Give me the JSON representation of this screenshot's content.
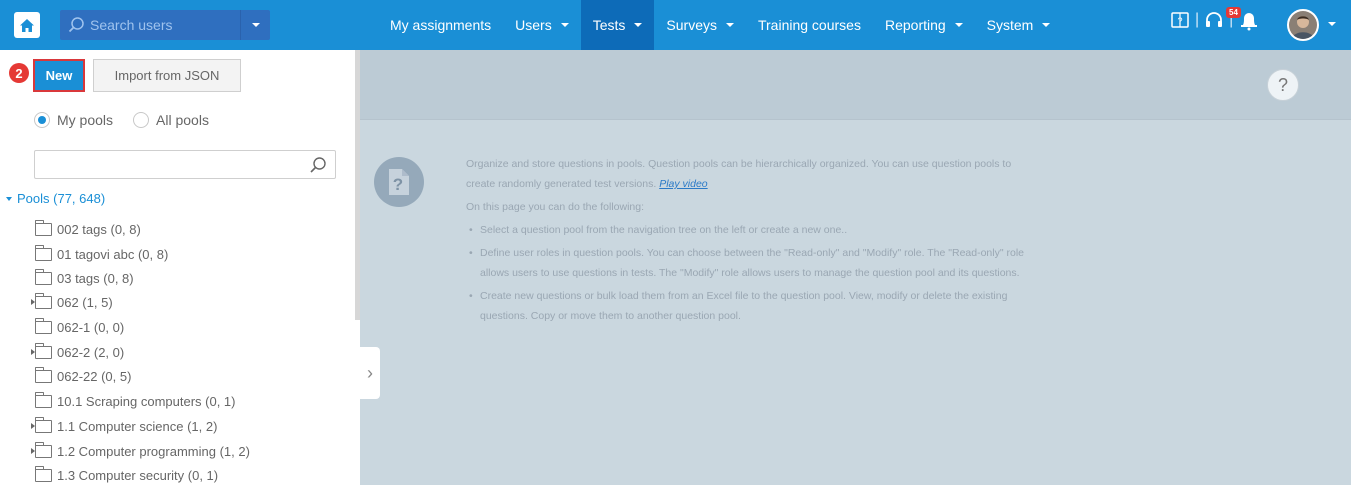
{
  "header": {
    "search_placeholder": "Search users",
    "nav": [
      {
        "label": "My assignments",
        "dropdown": false,
        "active": false
      },
      {
        "label": "Users",
        "dropdown": true,
        "active": false
      },
      {
        "label": "Tests",
        "dropdown": true,
        "active": true
      },
      {
        "label": "Surveys",
        "dropdown": true,
        "active": false
      },
      {
        "label": "Training courses",
        "dropdown": false,
        "active": false
      },
      {
        "label": "Reporting",
        "dropdown": true,
        "active": false
      },
      {
        "label": "System",
        "dropdown": true,
        "active": false
      }
    ],
    "notification_count": "54",
    "icons": [
      "home-icon",
      "search-icon",
      "manual-icon",
      "headset-icon",
      "bell-icon",
      "avatar"
    ]
  },
  "toolbar": {
    "step_number": "2",
    "new_label": "New",
    "import_label": "Import from JSON"
  },
  "filter": {
    "my_pools_label": "My pools",
    "all_pools_label": "All pools",
    "selected": "My pools"
  },
  "tree": {
    "root_label": "Pools (77, 648)",
    "items": [
      {
        "label": "002 tags (0, 8)",
        "expandable": false
      },
      {
        "label": "01 tagovi abc (0, 8)",
        "expandable": false
      },
      {
        "label": "03 tags (0, 8)",
        "expandable": false
      },
      {
        "label": "062 (1, 5)",
        "expandable": true
      },
      {
        "label": "062-1 (0, 0)",
        "expandable": false
      },
      {
        "label": "062-2 (2, 0)",
        "expandable": true
      },
      {
        "label": "062-22 (0, 5)",
        "expandable": false
      },
      {
        "label": "10.1 Scraping computers (0, 1)",
        "expandable": false
      },
      {
        "label": "1.1 Computer science (1, 2)",
        "expandable": true
      },
      {
        "label": "1.2 Computer programming (1, 2)",
        "expandable": true
      },
      {
        "label": "1.3 Computer security (0, 1)",
        "expandable": false
      }
    ]
  },
  "info": {
    "intro": "Organize and store questions in pools. Question pools can be hierarchically organized. You can use question pools to create randomly generated test versions.",
    "play_video": "Play video",
    "subtitle": "On this page you can do the following:",
    "bullets": [
      "Select a question pool from the navigation tree on the left or create a new one..",
      "Define user roles in question pools. You can choose between the \"Read-only\" and \"Modify\" role. The \"Read-only\" role allows users to use questions in tests. The \"Modify\" role allows users to manage the question pool and its questions.",
      "Create new questions or bulk load them from an Excel file to the question pool. View, modify or delete the existing questions. Copy or move them to another question pool."
    ],
    "help_label": "?"
  },
  "colors": {
    "topbar": "#1a8fd6",
    "active_nav": "#0d6bb8",
    "search_bg": "#2f6fbf",
    "highlight_red": "#e53935",
    "right_panel_bg": "#cad7df"
  }
}
